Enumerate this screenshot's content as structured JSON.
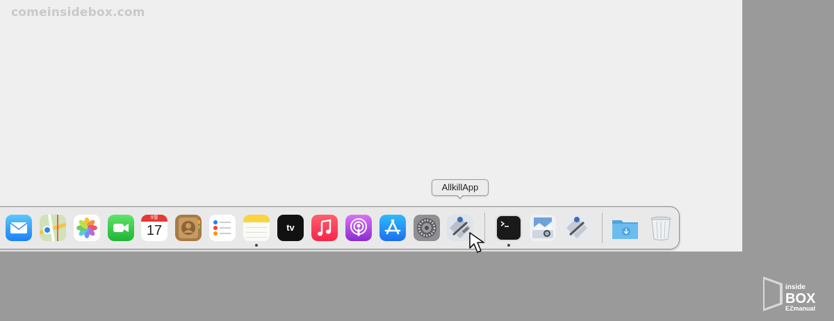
{
  "watermark": "comeinsidebox.com",
  "tooltip": "AllkillApp",
  "dock": {
    "apps": [
      {
        "name": "Mail",
        "icon": "mail-icon"
      },
      {
        "name": "Maps",
        "icon": "maps-icon"
      },
      {
        "name": "Photos",
        "icon": "photos-icon"
      },
      {
        "name": "FaceTime",
        "icon": "facetime-icon"
      },
      {
        "name": "Calendar",
        "icon": "calendar-icon",
        "month": "9월",
        "day": "17"
      },
      {
        "name": "Contacts",
        "icon": "contacts-icon"
      },
      {
        "name": "Reminders",
        "icon": "reminders-icon"
      },
      {
        "name": "Notes",
        "icon": "notes-icon",
        "running": true
      },
      {
        "name": "Apple TV",
        "icon": "apple-tv-icon",
        "label": "tv"
      },
      {
        "name": "Music",
        "icon": "music-icon"
      },
      {
        "name": "Podcasts",
        "icon": "podcasts-icon"
      },
      {
        "name": "App Store",
        "icon": "app-store-icon"
      },
      {
        "name": "System Preferences",
        "icon": "system-preferences-icon"
      },
      {
        "name": "AllkillApp",
        "icon": "allkillapp-icon",
        "hovered": true
      },
      {
        "name": "Terminal",
        "icon": "terminal-icon",
        "running": true
      },
      {
        "name": "Preview",
        "icon": "preview-icon"
      },
      {
        "name": "Script Editor",
        "icon": "script-editor-icon"
      },
      {
        "name": "Downloads",
        "icon": "downloads-folder-icon"
      },
      {
        "name": "Trash",
        "icon": "trash-icon"
      }
    ]
  },
  "logo": {
    "line1": "inside",
    "line2": "BOX",
    "line3": "EZmanual"
  },
  "colors": {
    "desktop": "#efefef",
    "background": "#9a9a9a",
    "dock": "#e8e8e8"
  }
}
